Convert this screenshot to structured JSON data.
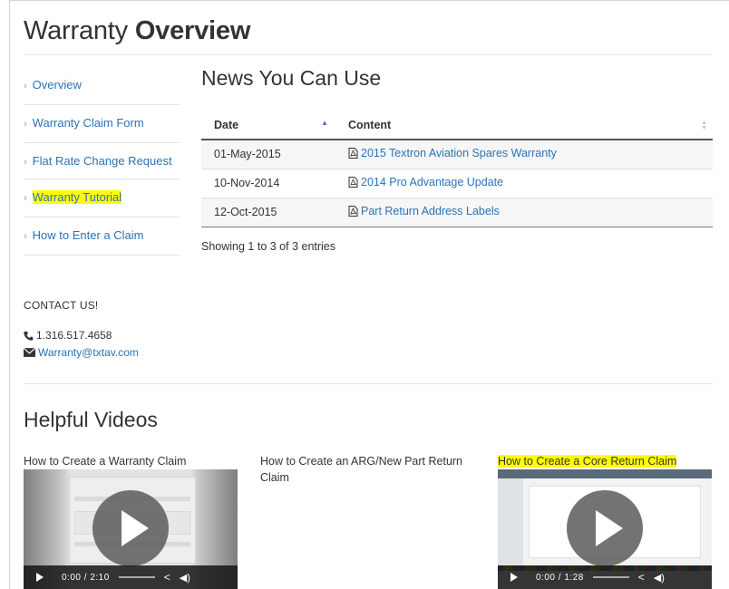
{
  "page": {
    "title_light": "Warranty ",
    "title_bold": "Overview"
  },
  "sidebar": {
    "items": [
      {
        "label": "Overview"
      },
      {
        "label": "Warranty Claim Form"
      },
      {
        "label": "Flat Rate Change Request"
      },
      {
        "label": "Warranty Tutorial"
      },
      {
        "label": "How to Enter a Claim"
      }
    ]
  },
  "contact": {
    "heading": "CONTACT US!",
    "phone": "1.316.517.4658",
    "email": "Warranty@txtav.com",
    "phone_icon": "phone-icon",
    "email_icon": "envelope-icon"
  },
  "news": {
    "title": "News You Can Use",
    "columns": [
      "Date",
      "Content"
    ],
    "rows": [
      {
        "date": "01-May-2015",
        "content": "2015 Textron Aviation Spares Warranty"
      },
      {
        "date": "10-Nov-2014",
        "content": "2014 Pro Advantage Update"
      },
      {
        "date": "12-Oct-2015",
        "content": "Part Return Address Labels"
      }
    ],
    "info": "Showing 1 to 3 of 3 entries",
    "file_icon": "pdf-file-icon"
  },
  "videos": {
    "title": "Helpful Videos",
    "items": [
      {
        "title": "How to Create a Warranty Claim",
        "current": "0:00",
        "duration": "2:10"
      },
      {
        "title": "How to Create an ARG/New Part Return Claim"
      },
      {
        "title": "How to Create a Core Return Claim",
        "current": "0:00",
        "duration": "1:28"
      }
    ]
  },
  "colors": {
    "link": "#2a73b7",
    "highlight": "#ffff00",
    "text": "#333333"
  }
}
